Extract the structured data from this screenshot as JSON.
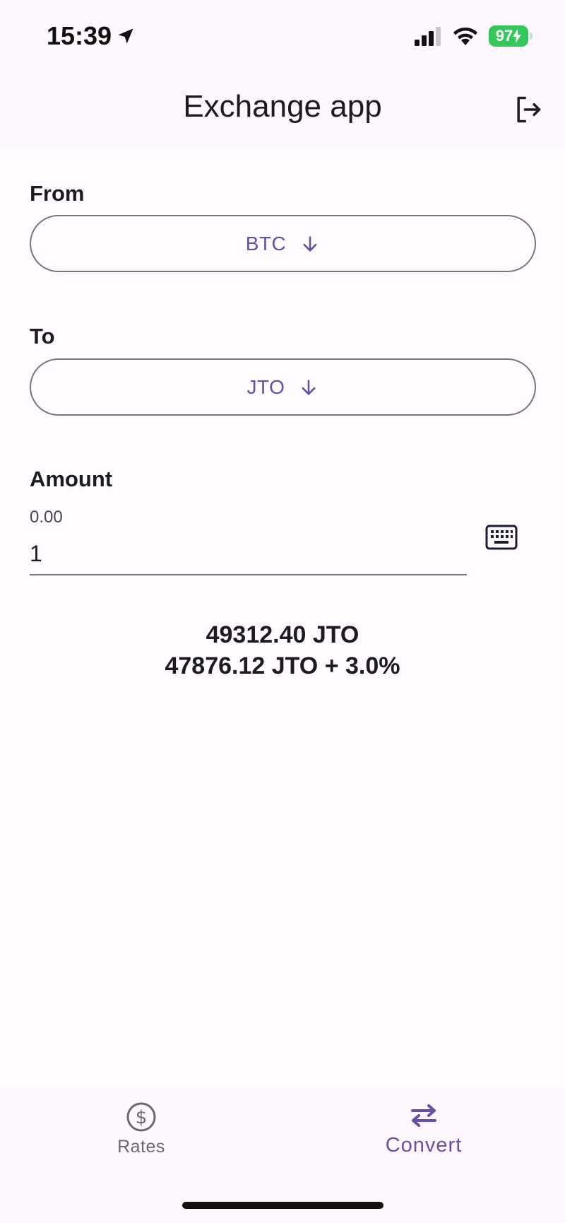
{
  "status_bar": {
    "time": "15:39",
    "battery": "97"
  },
  "app_bar": {
    "title": "Exchange app"
  },
  "from": {
    "label": "From",
    "value": "BTC"
  },
  "to": {
    "label": "To",
    "value": "JTO"
  },
  "amount": {
    "label": "Amount",
    "hint": "0.00",
    "value": "1"
  },
  "result": {
    "line1": "49312.40 JTO",
    "line2": "47876.12 JTO + 3.0%"
  },
  "nav": {
    "rates_label": "Rates",
    "convert_label": "Convert"
  },
  "colors": {
    "accent": "#6750a4",
    "outline": "#79747e",
    "battery": "#34c759"
  },
  "icons": {
    "location": "location-arrow-icon",
    "signal": "cellular-signal-icon",
    "wifi": "wifi-icon",
    "logout": "logout-icon",
    "dropdown": "arrow-down-icon",
    "keyboard": "keyboard-icon",
    "rates": "dollar-circle-icon",
    "convert": "swap-arrows-icon"
  }
}
